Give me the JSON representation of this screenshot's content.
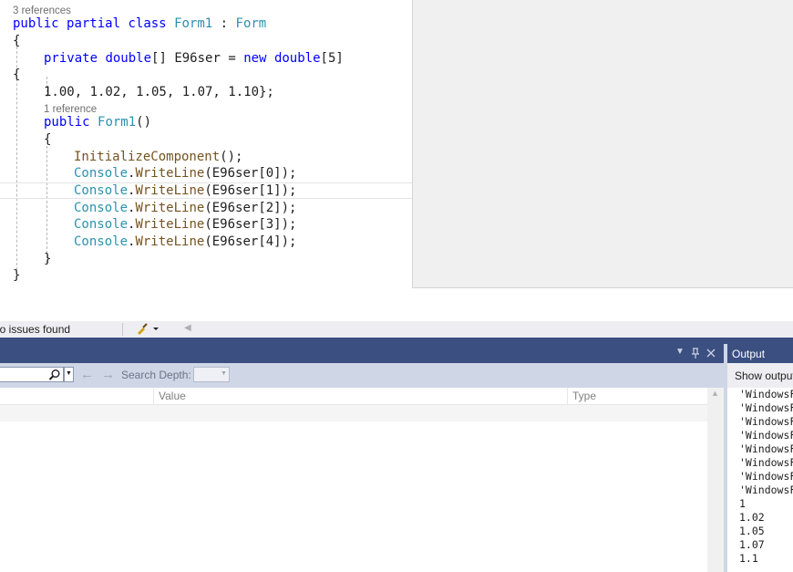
{
  "editor": {
    "lens_class": "3 references",
    "lens_ctor": "1 reference",
    "line_class": {
      "kw1": "public",
      "kw2": "partial",
      "kw3": "class",
      "name": "Form1",
      "colon": " : ",
      "base": "Form"
    },
    "brace_open": "{",
    "brace_close": "}",
    "line_field": {
      "kw1": "private",
      "ty": "double",
      "arr": "[] ",
      "name": "E96ser",
      "eq": " = ",
      "kw2": "new",
      "ty2": "double",
      "size": "[5]"
    },
    "line_values": "1.00, 1.02, 1.05, 1.07, 1.10};",
    "line_ctor": {
      "kw": "public",
      "name": "Form1",
      "parens": "()"
    },
    "init_call": "InitializeComponent",
    "init_tail": "();",
    "console_type": "Console",
    "writeline": "WriteLine",
    "calls": [
      "(E96ser[0]);",
      "(E96ser[1]);",
      "(E96ser[2]);",
      "(E96ser[3]);",
      "(E96ser[4]);"
    ]
  },
  "status": {
    "issues": "No issues found"
  },
  "locals": {
    "search_depth_label": "Search Depth:",
    "columns": [
      "Value",
      "Type"
    ]
  },
  "output": {
    "title": "Output",
    "show_output_label": "Show output from:",
    "lines": [
      "'WindowsFormsApp",
      "'WindowsFormsApp",
      "'WindowsFormsApp",
      "'WindowsFormsApp",
      "'WindowsFormsApp",
      "'WindowsFormsApp",
      "'WindowsFormsApp",
      "'WindowsFormsApp",
      "1",
      "1.02",
      "1.05",
      "1.07",
      "1.1"
    ]
  },
  "colors": {
    "keyword": "#0000ff",
    "type": "#2b91af",
    "method": "#74531f",
    "panel_title": "#3b4f81"
  }
}
